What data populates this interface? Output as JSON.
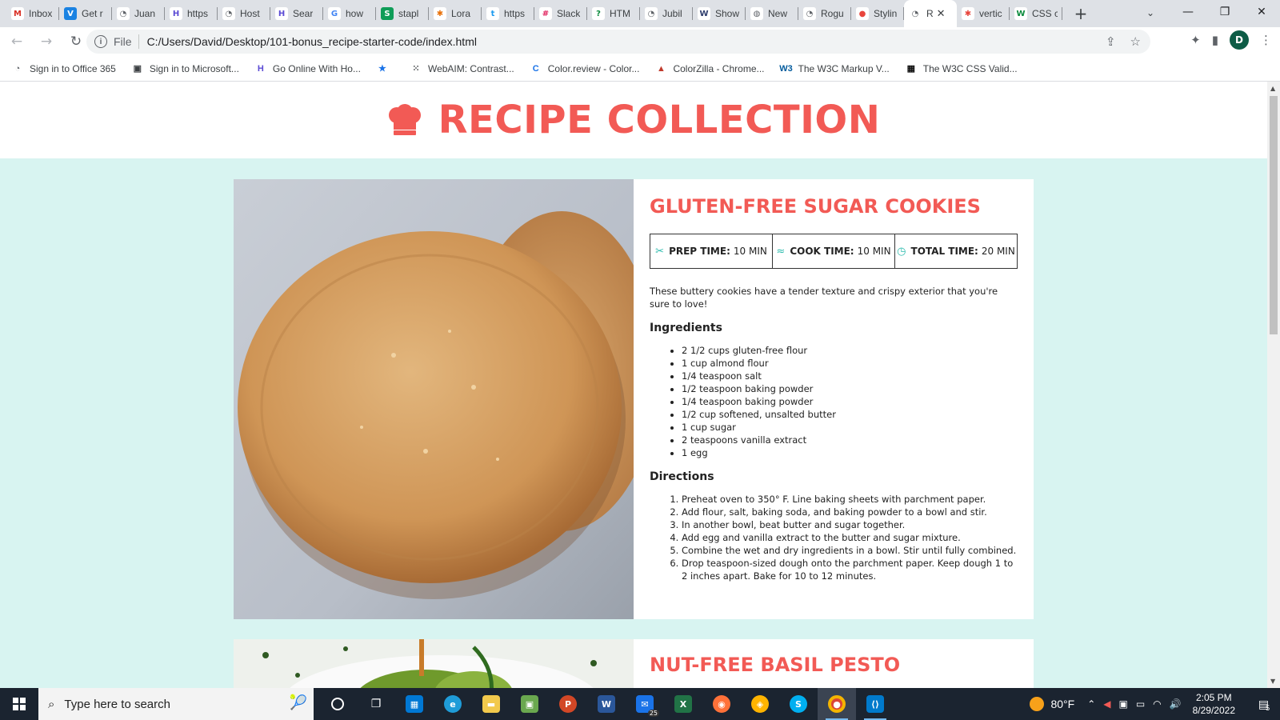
{
  "browser": {
    "tabs": [
      {
        "title": "Inbox",
        "fav": "M",
        "color": "#ffffff",
        "fg": "#d93025"
      },
      {
        "title": "Get r",
        "fav": "V",
        "color": "#1a82e2",
        "fg": "#ffffff"
      },
      {
        "title": "Juan",
        "fav": "◔",
        "color": "#ffffff",
        "fg": "#5f6368"
      },
      {
        "title": "https",
        "fav": "H",
        "color": "#ffffff",
        "fg": "#5b4bd4"
      },
      {
        "title": "Host",
        "fav": "◔",
        "color": "#ffffff",
        "fg": "#5f6368"
      },
      {
        "title": "Sear",
        "fav": "H",
        "color": "#ffffff",
        "fg": "#5b4bd4"
      },
      {
        "title": "how",
        "fav": "G",
        "color": "#ffffff",
        "fg": "#4285f4"
      },
      {
        "title": "stapl",
        "fav": "S",
        "color": "#0f9d58",
        "fg": "#ffffff"
      },
      {
        "title": "Lora",
        "fav": "✱",
        "color": "#ffffff",
        "fg": "#e8710a"
      },
      {
        "title": "https",
        "fav": "t",
        "color": "#ffffff",
        "fg": "#1d9bf0"
      },
      {
        "title": "Slack",
        "fav": "#",
        "color": "#ffffff",
        "fg": "#e01e5a"
      },
      {
        "title": "HTM",
        "fav": "?",
        "color": "#ffffff",
        "fg": "#0a8a3c"
      },
      {
        "title": "Jubil",
        "fav": "◔",
        "color": "#ffffff",
        "fg": "#5f6368"
      },
      {
        "title": "Show",
        "fav": "W",
        "color": "#ffffff",
        "fg": "#2e3d6d"
      },
      {
        "title": "New",
        "fav": "◍",
        "color": "#ffffff",
        "fg": "#5f6368"
      },
      {
        "title": "Rogu",
        "fav": "◔",
        "color": "#ffffff",
        "fg": "#5f6368"
      },
      {
        "title": "Stylin",
        "fav": "●",
        "color": "#ffffff",
        "fg": "#e8453c"
      },
      {
        "title": "R",
        "fav": "◔",
        "color": "#ffffff",
        "fg": "#5f6368",
        "active": true
      },
      {
        "title": "vertic",
        "fav": "✱",
        "color": "#ffffff",
        "fg": "#e8453c"
      },
      {
        "title": "CSS c",
        "fav": "W",
        "color": "#ffffff",
        "fg": "#0a8a3c"
      }
    ],
    "new_tab": "+",
    "close_tab": "✕",
    "tab_search": "⌄",
    "window": {
      "minimize": "—",
      "restore": "❐",
      "close": "✕"
    },
    "back": "←",
    "forward": "→",
    "reload": "↻",
    "info": "i",
    "scheme": "File",
    "url": "C:/Users/David/Desktop/101-bonus_recipe-starter-code/index.html",
    "share": "⇪",
    "star": "☆",
    "extensions": "✦",
    "sidepanel": "▮",
    "avatar": "D",
    "menu": "⋮",
    "bookmarks": [
      {
        "label": "Sign in to Office 365",
        "icon": "◔",
        "fg": "#5f6368"
      },
      {
        "label": "Sign in to Microsoft...",
        "icon": "▣",
        "fg": "#3c4043"
      },
      {
        "label": "Go Online With Ho...",
        "icon": "H",
        "fg": "#5b4bd4"
      },
      {
        "label": "",
        "icon": "★",
        "fg": "#1a73e8"
      },
      {
        "label": "WebAIM: Contrast...",
        "icon": "⁙",
        "fg": "#3c4043"
      },
      {
        "label": "Color.review - Color...",
        "icon": "C",
        "fg": "#1a73e8"
      },
      {
        "label": "ColorZilla - Chrome...",
        "icon": "▲",
        "fg": "#c0392b"
      },
      {
        "label": "The W3C Markup V...",
        "icon": "W3",
        "fg": "#005a9c"
      },
      {
        "label": "The W3C CSS Valid...",
        "icon": "▦",
        "fg": "#111111"
      }
    ]
  },
  "page": {
    "site_title": "RECIPE COLLECTION",
    "recipes": [
      {
        "title": "GLUTEN-FREE SUGAR COOKIES",
        "prep_label": "PREP TIME:",
        "prep_value": "10 MIN",
        "cook_label": "COOK TIME:",
        "cook_value": "10 MIN",
        "total_label": "TOTAL TIME:",
        "total_value": "20 MIN",
        "description": "These buttery cookies have a tender texture and crispy exterior that you're sure to love!",
        "ingredients_heading": "Ingredients",
        "ingredients": [
          "2 1/2 cups gluten-free flour",
          "1 cup almond flour",
          "1/4 teaspoon salt",
          "1/2 teaspoon baking powder",
          "1/4 teaspoon baking powder",
          "1/2 cup softened, unsalted butter",
          "1 cup sugar",
          "2 teaspoons vanilla extract",
          "1 egg"
        ],
        "directions_heading": "Directions",
        "directions": [
          "Preheat oven to 350° F. Line baking sheets with parchment paper.",
          "Add flour, salt, baking soda, and baking powder to a bowl and stir.",
          "In another bowl, beat butter and sugar together.",
          "Add egg and vanilla extract to the butter and sugar mixture.",
          "Combine the wet and dry ingredients in a bowl. Stir until fully combined.",
          "Drop teaspoon-sized dough onto the parchment paper. Keep dough 1 to 2 inches apart. Bake for 10 to 12 minutes."
        ]
      },
      {
        "title": "NUT-FREE BASIL PESTO"
      }
    ],
    "colors": {
      "accent": "#f25a55",
      "background": "#d8f4f1",
      "icon": "#2bbbad"
    }
  },
  "taskbar": {
    "search_placeholder": "Type here to search",
    "weather": "80°F",
    "time": "2:05 PM",
    "date": "8/29/2022",
    "mail_badge": "25",
    "notifications": "5",
    "apps": [
      "cortana",
      "task-view",
      "store",
      "edge",
      "file-explorer",
      "app",
      "powerpoint",
      "word",
      "mail",
      "excel",
      "firefox",
      "app-2",
      "skype",
      "chrome",
      "vscode"
    ]
  }
}
